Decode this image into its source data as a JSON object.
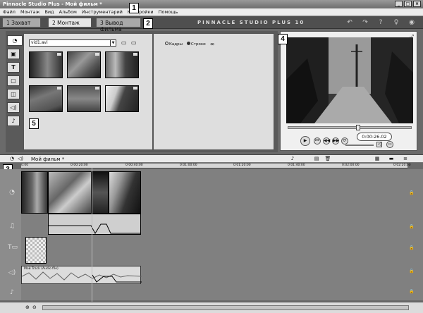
{
  "window": {
    "title": "Pinnacle Studio Plus - Мой фильм *"
  },
  "menu": [
    "Файл",
    "Монтаж",
    "Вид",
    "Альбом",
    "Инструментарий",
    "Настройки",
    "Помощь"
  ],
  "tabs": [
    {
      "label": "1 Захват",
      "active": false
    },
    {
      "label": "2 Монтаж",
      "active": true
    },
    {
      "label": "3 Вывод фильма",
      "active": false
    }
  ],
  "brand": "PINNACLE STUDIO PLUS 10",
  "callouts": {
    "one": "1",
    "two": "2",
    "three": "3",
    "four": "4",
    "five": "5"
  },
  "album": {
    "file": "vid1.avi",
    "view_options": [
      "Кадры",
      "Строки"
    ]
  },
  "player": {
    "timecode": "0:00:26.02"
  },
  "timeline": {
    "title": "Мой фильм *",
    "ruler": [
      "0:00",
      "0:00:20:00",
      "0:00:40:00",
      "0:01:00:00",
      "0:01:20:00",
      "0:01:40:00",
      "0:02:00:00",
      "0:02:20:00"
    ],
    "audio_label": "Мой Track (Audio file)"
  },
  "icons": {
    "side_tabs": [
      "video-camera-icon",
      "photo-icon",
      "title-text-icon",
      "still-image-icon",
      "transition-icon",
      "sound-effect-icon",
      "microphone-icon"
    ],
    "player_controls": [
      "play-icon",
      "rewind-icon",
      "prev-frame-icon",
      "next-frame-icon",
      "loop-icon"
    ]
  }
}
